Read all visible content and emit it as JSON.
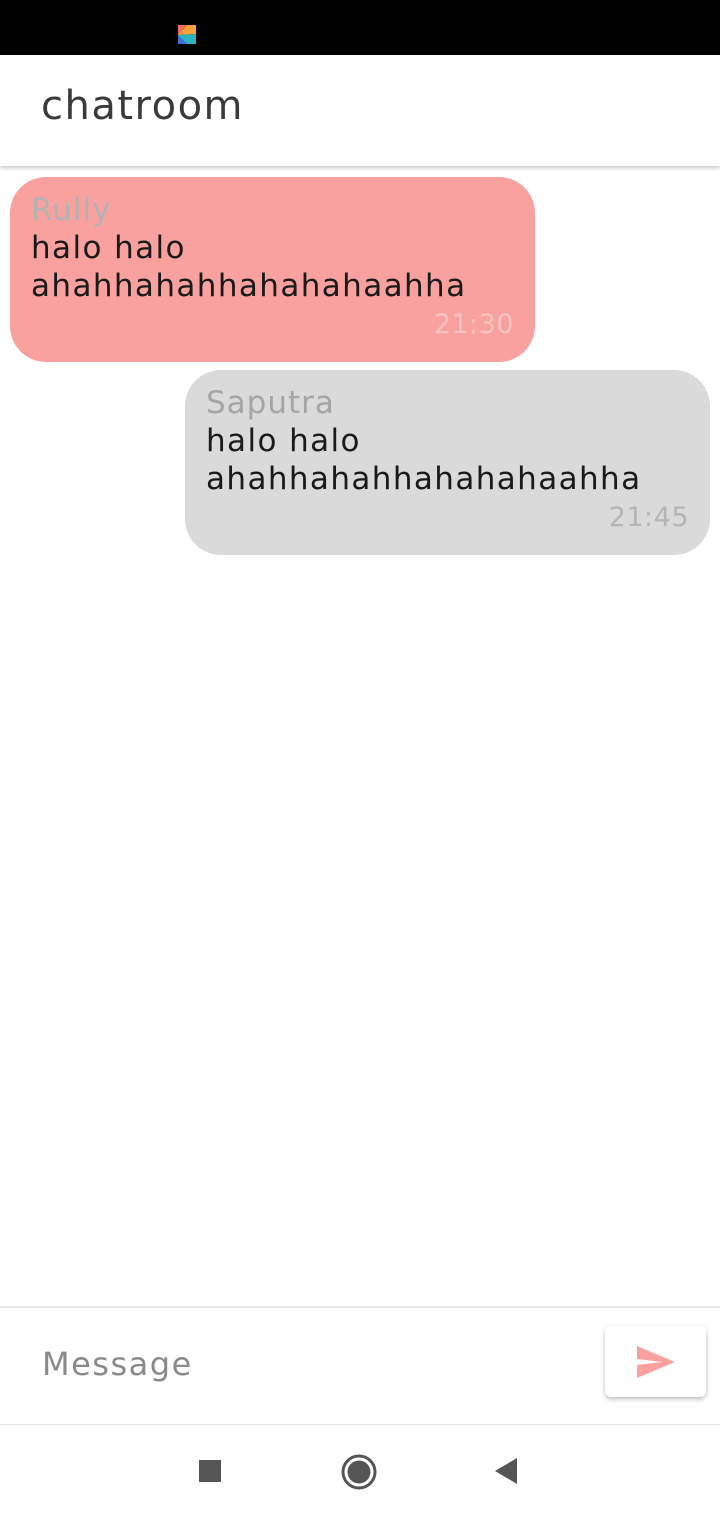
{
  "status_bar": {
    "app_icon": "kite-app-icon"
  },
  "header": {
    "title": "chatroom"
  },
  "messages": [
    {
      "sender": "Rully",
      "text": "halo halo\nahahhahahhahahahaahha",
      "time": "21:30",
      "direction": "incoming",
      "bubble_color": "#f9a19f"
    },
    {
      "sender": "Saputra",
      "text": "halo halo\nahahhahahhahahahaahha",
      "time": "21:45",
      "direction": "outgoing",
      "bubble_color": "#dadada"
    }
  ],
  "composer": {
    "placeholder": "Message",
    "value": "",
    "send_icon": "send-icon",
    "send_icon_color": "#f9a19f"
  },
  "nav": {
    "recents_icon": "square-icon",
    "home_icon": "circle-icon",
    "back_icon": "triangle-back-icon"
  }
}
